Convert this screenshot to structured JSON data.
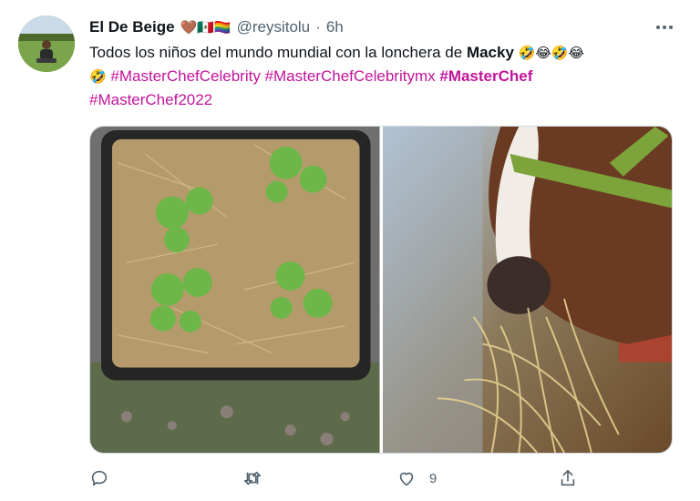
{
  "author": {
    "display_name": "El De Beige",
    "name_emojis": "🤎🇲🇽🏳️‍🌈",
    "handle": "@reysitolu",
    "separator": "·",
    "time": "6h"
  },
  "tweet": {
    "line1_text": "Todos los niños del mundo mundial con la lonchera de ",
    "line1_bold": "Macky",
    "line1_emojis": "🤣😂🤣😂",
    "line2_emoji": "🤣",
    "hashtags": [
      "#MasterChefCelebrity",
      "#MasterChefCelebritymx",
      "#MasterChef",
      "#MasterChef2022"
    ]
  },
  "media": {
    "left_image": "plants-in-straw-planter",
    "right_image": "horse-eating-hay"
  },
  "actions": {
    "reply_count": "",
    "retweet_count": "",
    "like_count": "9"
  },
  "colors": {
    "hashtag": "#c2149b",
    "secondary_text": "#536471"
  }
}
